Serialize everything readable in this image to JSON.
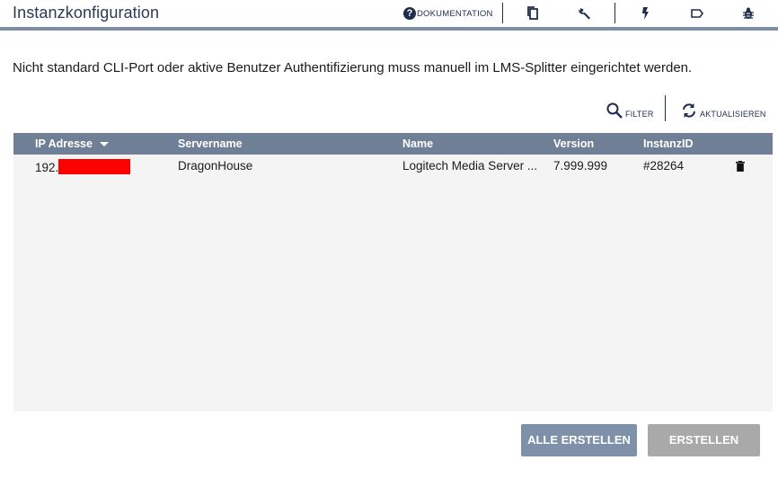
{
  "header": {
    "title": "Instanzkonfiguration",
    "doc_label": "DOKUMENTATION",
    "icons": [
      "help-icon",
      "copy-icon",
      "wrench-icon",
      "bolt-icon",
      "tag-icon",
      "bug-icon"
    ]
  },
  "notice": "Nicht standard CLI-Port oder aktive Benutzer Authentifizierung muss manuell im LMS-Splitter eingerichtet werden.",
  "toolbar": {
    "filter_label": "FILTER",
    "refresh_label": "AKTUALISIEREN"
  },
  "table": {
    "columns": [
      "IP Adresse",
      "Servername",
      "Name",
      "Version",
      "InstanzID"
    ],
    "sort_column": "IP Adresse",
    "rows": [
      {
        "ip_prefix": "192.",
        "servername": "DragonHouse",
        "name": "Logitech Media Server ...",
        "version": "7.999.999",
        "instanz_id": "#28264"
      }
    ]
  },
  "buttons": {
    "all_create": "ALLE ERSTELLEN",
    "create": "ERSTELLEN"
  },
  "colors": {
    "header_bar": "#7d8ea4",
    "table_header": "#6f8096",
    "table_body": "#f4f4f4",
    "primary_button": "#7f91a8",
    "disabled_button": "#a9a9a9",
    "redaction": "#ff0000"
  }
}
